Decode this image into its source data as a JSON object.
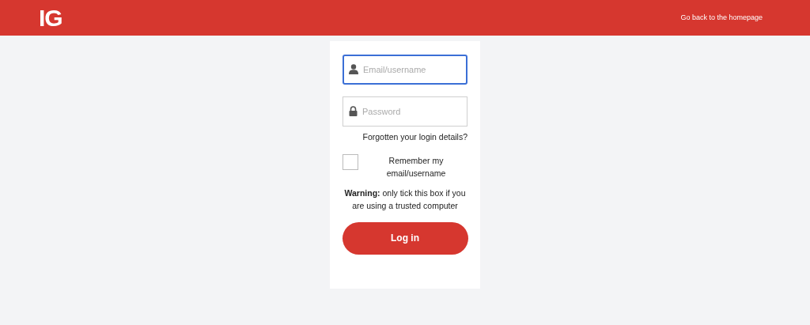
{
  "header": {
    "logo": "IG",
    "link": "Go back to the homepage"
  },
  "login": {
    "email": {
      "placeholder": "Email/username",
      "focused": true
    },
    "password": {
      "placeholder": "Password",
      "focused": false
    },
    "forgot_link": "Forgotten your login details?",
    "remember": {
      "label": "Remember my email/username",
      "checked": false
    },
    "warning": "**Warning:** only tick this box if you are using a trusted computer",
    "button": "Log in"
  }
}
